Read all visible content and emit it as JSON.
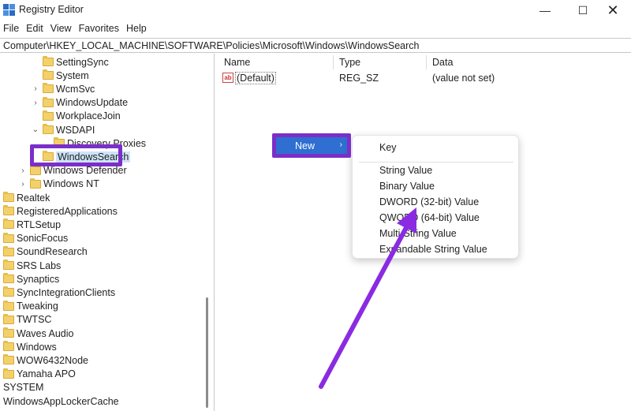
{
  "window": {
    "title": "Registry Editor",
    "controls": {
      "minimize": "—",
      "maximize": "☐",
      "close": "✕"
    }
  },
  "menu": [
    "File",
    "Edit",
    "View",
    "Favorites",
    "Help"
  ],
  "address": "Computer\\HKEY_LOCAL_MACHINE\\SOFTWARE\\Policies\\Microsoft\\Windows\\WindowsSearch",
  "tree": {
    "items": [
      {
        "label": "SettingSync",
        "level": 3,
        "expander": ""
      },
      {
        "label": "System",
        "level": 3,
        "expander": ""
      },
      {
        "label": "WcmSvc",
        "level": 3,
        "expander": "›"
      },
      {
        "label": "WindowsUpdate",
        "level": 3,
        "expander": "›"
      },
      {
        "label": "WorkplaceJoin",
        "level": 3,
        "expander": ""
      },
      {
        "label": "WSDAPI",
        "level": 3,
        "expander": "⌄"
      },
      {
        "label": "Discovery Proxies",
        "level": 4,
        "expander": ""
      },
      {
        "label": "WindowsSearch",
        "level": 3,
        "expander": "",
        "selected": true
      },
      {
        "label": "Windows Defender",
        "level": 2,
        "expander": "›"
      },
      {
        "label": "Windows NT",
        "level": 2,
        "expander": "›"
      },
      {
        "label": "Realtek",
        "level": 0,
        "expander": ""
      },
      {
        "label": "RegisteredApplications",
        "level": 0,
        "expander": ""
      },
      {
        "label": "RTLSetup",
        "level": 0,
        "expander": ""
      },
      {
        "label": "SonicFocus",
        "level": 0,
        "expander": ""
      },
      {
        "label": "SoundResearch",
        "level": 0,
        "expander": ""
      },
      {
        "label": "SRS Labs",
        "level": 0,
        "expander": ""
      },
      {
        "label": "Synaptics",
        "level": 0,
        "expander": ""
      },
      {
        "label": "SyncIntegrationClients",
        "level": 0,
        "expander": ""
      },
      {
        "label": "Tweaking",
        "level": 0,
        "expander": ""
      },
      {
        "label": "TWTSC",
        "level": 0,
        "expander": ""
      },
      {
        "label": "Waves Audio",
        "level": 0,
        "expander": ""
      },
      {
        "label": "Windows",
        "level": 0,
        "expander": ""
      },
      {
        "label": "WOW6432Node",
        "level": 0,
        "expander": ""
      },
      {
        "label": "Yamaha APO",
        "level": 0,
        "expander": ""
      },
      {
        "label": "SYSTEM",
        "level": -1,
        "expander": ""
      },
      {
        "label": "WindowsAppLockerCache",
        "level": -1,
        "expander": ""
      }
    ]
  },
  "values_pane": {
    "columns": [
      "Name",
      "Type",
      "Data"
    ],
    "rows": [
      {
        "name": "(Default)",
        "type": "REG_SZ",
        "data": "(value not set)"
      }
    ]
  },
  "context_menu": {
    "new_label": "New",
    "submenu": [
      "Key",
      "String Value",
      "Binary Value",
      "DWORD (32-bit) Value",
      "QWORD (64-bit) Value",
      "Multi-String Value",
      "Expandable String Value"
    ]
  },
  "colors": {
    "highlight_purple": "#7b2fc9",
    "selection_blue": "#2f6fd1",
    "folder_yellow": "#f3d16a"
  }
}
